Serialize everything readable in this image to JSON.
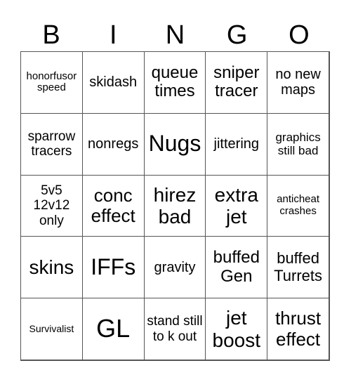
{
  "header": {
    "letters": [
      "B",
      "I",
      "N",
      "G",
      "O"
    ]
  },
  "grid": {
    "rows": [
      [
        "honorfusor speed",
        "skidash",
        "queue times",
        "sniper tracer",
        "no new maps"
      ],
      [
        "sparrow tracers",
        "nonregs",
        "Nugs",
        "jittering",
        "graphics still bad"
      ],
      [
        "5v5 12v12 only",
        "conc effect",
        "hirez bad",
        "extra jet",
        "anticheat crashes"
      ],
      [
        "skins",
        "IFFs",
        "gravity",
        "buffed Gen",
        "buffed Turrets"
      ],
      [
        "Survivalist",
        "GL",
        "stand still to k out",
        "jet boost",
        "thrust effect"
      ]
    ]
  }
}
